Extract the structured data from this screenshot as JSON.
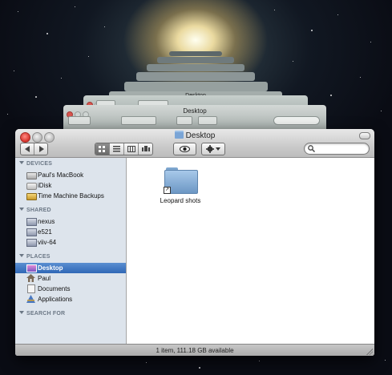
{
  "window": {
    "title": "Desktop",
    "status": "1 item, 111.18 GB available"
  },
  "background_stack": {
    "title": "Desktop"
  },
  "toolbar": {
    "back_icon": "chevron-left-icon",
    "forward_icon": "chevron-right-icon",
    "view_modes": [
      "icon-view",
      "list-view",
      "column-view",
      "cover-flow-view"
    ],
    "active_view": "icon-view",
    "quicklook_icon": "eye-icon",
    "action_icon": "gear-icon"
  },
  "sidebar": {
    "sections": [
      {
        "header": "DEVICES",
        "items": [
          {
            "label": "Paul's MacBook",
            "icon": "hard-disk-icon"
          },
          {
            "label": "iDisk",
            "icon": "idisk-icon"
          },
          {
            "label": "Time Machine Backups",
            "icon": "backup-disk-icon"
          }
        ]
      },
      {
        "header": "SHARED",
        "items": [
          {
            "label": "nexus",
            "icon": "network-computer-icon"
          },
          {
            "label": "e521",
            "icon": "network-computer-icon"
          },
          {
            "label": "viiv-64",
            "icon": "network-computer-icon"
          }
        ]
      },
      {
        "header": "PLACES",
        "items": [
          {
            "label": "Desktop",
            "icon": "desktop-icon",
            "selected": true
          },
          {
            "label": "Paul",
            "icon": "home-icon"
          },
          {
            "label": "Documents",
            "icon": "documents-icon"
          },
          {
            "label": "Applications",
            "icon": "applications-icon"
          }
        ]
      },
      {
        "header": "SEARCH FOR",
        "items": []
      }
    ]
  },
  "files": [
    {
      "name": "Leopard shots",
      "icon": "folder-alias-icon"
    }
  ],
  "colors": {
    "selection": "#3a72bf",
    "sidebar_bg": "#dde4ec",
    "close_button": "#d6312a"
  }
}
